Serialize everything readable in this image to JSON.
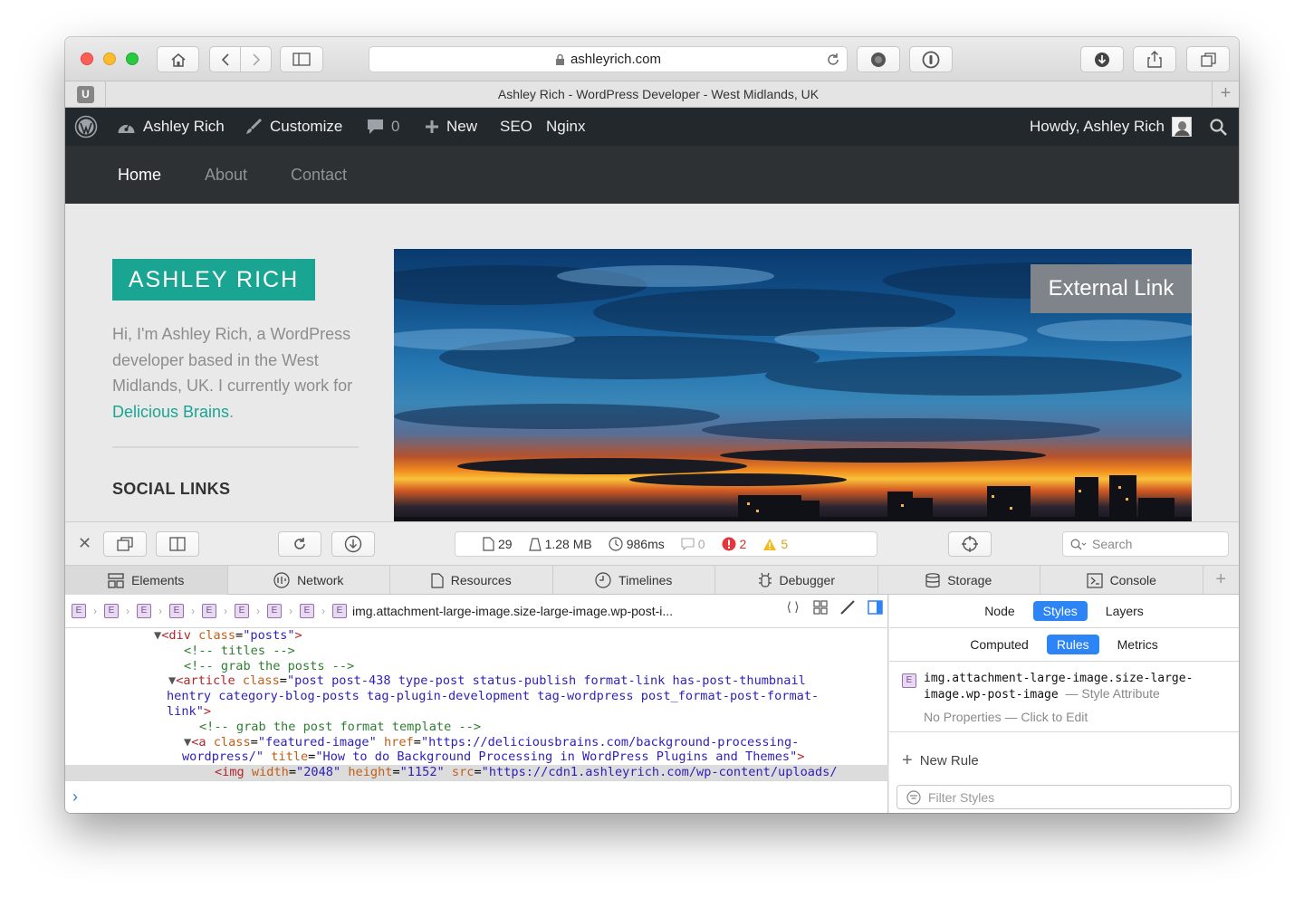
{
  "browser": {
    "url": "ashleyrich.com",
    "tab_title": "Ashley Rich - WordPress Developer - West Midlands, UK",
    "extension_badge": "U"
  },
  "admin_bar": {
    "site_name": "Ashley Rich",
    "customize": "Customize",
    "comments_count": "0",
    "new": "New",
    "seo": "SEO",
    "nginx": "Nginx",
    "howdy": "Howdy, Ashley Rich"
  },
  "site_nav": {
    "items": [
      {
        "label": "Home",
        "active": true
      },
      {
        "label": "About",
        "active": false
      },
      {
        "label": "Contact",
        "active": false
      }
    ]
  },
  "sidebar_site": {
    "brand": "ASHLEY RICH",
    "bio_text": "Hi, I'm Ashley Rich, a WordPress developer based in the West Midlands, UK. I currently work for ",
    "bio_link": "Delicious Brains",
    "bio_end": ".",
    "social_heading": "SOCIAL LINKS"
  },
  "hero": {
    "badge": "External Link"
  },
  "devtools": {
    "stats": {
      "resources": "29",
      "size": "1.28 MB",
      "time": "986ms",
      "logs": "0",
      "errors": "2",
      "warnings": "5"
    },
    "search_placeholder": "Search",
    "tabs": [
      "Elements",
      "Network",
      "Resources",
      "Timelines",
      "Debugger",
      "Storage",
      "Console"
    ],
    "breadcrumb_last": "img.attachment-large-image.size-large-image.wp-post-i...",
    "dom_lines": {
      "l1_tag": "<div ",
      "l1_attr": "class",
      "l1_val": "\"posts\"",
      "l1_end": ">",
      "l2": "<!-- titles -->",
      "l3": "<!-- grab the posts -->",
      "l4_tag": "<article ",
      "l4_attr": "class",
      "l4_val": "\"post post-438 type-post status-publish format-link has-post-thumbnail",
      "l5_val": "hentry category-blog-posts tag-plugin-development tag-wordpress post_format-post-format-",
      "l6_val": "link\"",
      "l6_end": ">",
      "l7": "<!-- grab the post format template -->",
      "l8_tag": "<a ",
      "l8_attr": "class",
      "l8_val": "\"featured-image\"",
      "l8_attr2": "href",
      "l8_val2": "\"https://deliciousbrains.com/background-processing-",
      "l9_val": "wordpress/\"",
      "l9_attr": "title",
      "l9_val2": "\"How to do Background Processing in WordPress Plugins and Themes\"",
      "l9_end": ">",
      "l10_tag": "<img ",
      "l10_attr1": "width",
      "l10_val1": "\"2048\"",
      "l10_attr2": "height",
      "l10_val2": "\"1152\"",
      "l10_attr3": "src",
      "l10_val3": "\"https://cdn1.ashleyrich.com/wp-content/uploads/"
    },
    "sidebar_tabs": [
      "Node",
      "Styles",
      "Layers"
    ],
    "sidebar_active": "Styles",
    "sub_tabs": [
      "Computed",
      "Rules",
      "Metrics"
    ],
    "sub_active": "Rules",
    "rule_selector": "img.attachment-large-image.size-large-image.wp-post-image",
    "rule_source": "— Style Attribute",
    "rule_empty": "No Properties — Click to Edit",
    "new_rule": "New Rule",
    "filter_placeholder": "Filter Styles"
  }
}
